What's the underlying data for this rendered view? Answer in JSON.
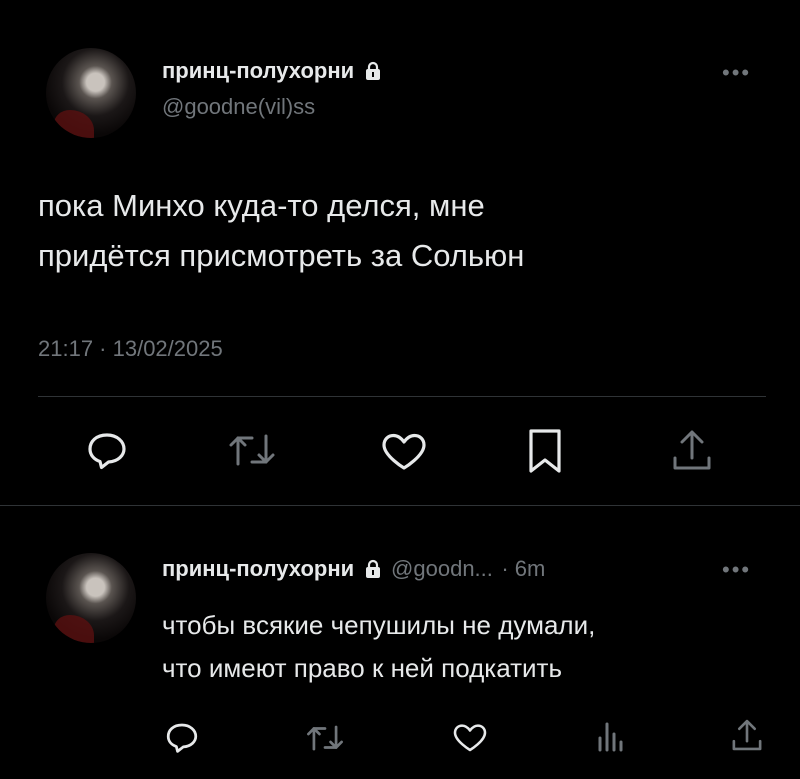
{
  "main_tweet": {
    "author_name": "принц-полухорни",
    "author_handle": "@goodne(vil)ss",
    "more_label": "•••",
    "text_line1": "пока Минхо куда-то делся, мне",
    "text_line2": "придётся присмотреть за Сольюн",
    "timestamp": "21:17 · 13/02/2025"
  },
  "reply": {
    "author_name": "принц-полухорни",
    "author_handle": "@goodn...",
    "time": "· 6m",
    "more_label": "•••",
    "text_line1": "чтобы всякие чепушилы не думали,",
    "text_line2": "что имеют право к ней подкатить"
  },
  "colors": {
    "background": "#000000",
    "text": "#e7e9ea",
    "secondary": "#71767b",
    "divider": "#2f3336"
  },
  "icons": [
    "reply-icon",
    "retweet-icon",
    "like-icon",
    "bookmark-icon",
    "share-icon",
    "views-icon",
    "lock-icon",
    "avatar"
  ]
}
